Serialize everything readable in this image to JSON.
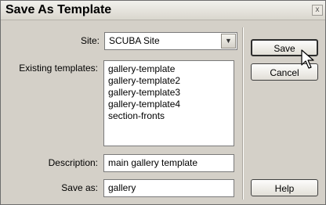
{
  "dialog": {
    "title": "Save As Template",
    "close_glyph": "x"
  },
  "site": {
    "label": "Site:",
    "value": "SCUBA Site",
    "arrow_glyph": "▼"
  },
  "existing": {
    "label": "Existing templates:",
    "items": [
      "gallery-template",
      "gallery-template2",
      "gallery-template3",
      "gallery-template4",
      "section-fronts"
    ]
  },
  "description": {
    "label": "Description:",
    "value": "main gallery template"
  },
  "save_as": {
    "label": "Save as:",
    "value": "gallery"
  },
  "buttons": {
    "save": "Save",
    "cancel": "Cancel",
    "help": "Help"
  },
  "icons": {
    "close": "close-icon",
    "dropdown": "chevron-down-icon",
    "pointer": "mouse-pointer-icon"
  }
}
